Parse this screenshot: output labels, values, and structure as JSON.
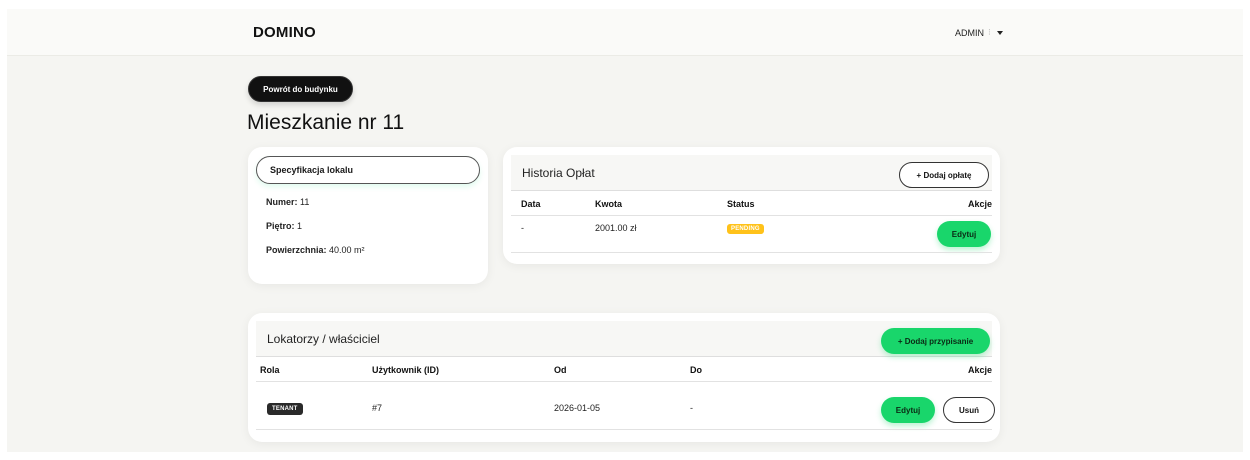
{
  "header": {
    "brand": "DOMINO",
    "user_label": "ADMIN",
    "user_separator": "⁝"
  },
  "page": {
    "back_button": "Powrót do budynku",
    "title": "Mieszkanie nr 11"
  },
  "specification": {
    "heading": "Specyfikacja lokalu",
    "rows": [
      {
        "label": "Numer:",
        "value": "11"
      },
      {
        "label": "Piętro:",
        "value": "1"
      },
      {
        "label": "Powierzchnia:",
        "value": "40.00 m²"
      }
    ]
  },
  "payments": {
    "title": "Historia Opłat",
    "add_button": "+ Dodaj opłatę",
    "columns": [
      "Data",
      "Kwota",
      "Status",
      "Akcje"
    ],
    "rows": [
      {
        "date": "-",
        "amount": "2001.00 zł",
        "status": "PENDING",
        "action": "Edytuj"
      }
    ],
    "status_color": "#ffc21a"
  },
  "tenants": {
    "title": "Lokatorzy / właściciel",
    "add_button": "+ Dodaj przypisanie",
    "columns": [
      "Rola",
      "Użytkownik (ID)",
      "Od",
      "Do",
      "Akcje"
    ],
    "rows": [
      {
        "role": "TENANT",
        "user": "#7",
        "from": "2026-01-05",
        "to": "-",
        "edit": "Edytuj",
        "remove": "Usuń"
      }
    ]
  },
  "colors": {
    "accent_green": "#19d66b",
    "dark": "#111111",
    "background": "#f5f5f2"
  }
}
